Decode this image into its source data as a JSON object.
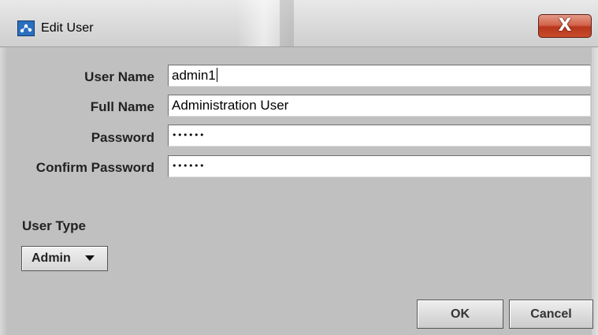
{
  "window": {
    "title": "Edit User",
    "close_label": "X"
  },
  "form": {
    "user_name": {
      "label": "User Name",
      "value": "admin1"
    },
    "full_name": {
      "label": "Full Name",
      "value": "Administration User"
    },
    "password": {
      "label": "Password",
      "value": "••••••"
    },
    "confirm_password": {
      "label": "Confirm Password",
      "value": "••••••"
    }
  },
  "user_type": {
    "label": "User Type",
    "selected": "Admin"
  },
  "buttons": {
    "ok": "OK",
    "cancel": "Cancel"
  },
  "colors": {
    "dialog_background": "#c0c0c0",
    "close_button": "#c94a2c"
  },
  "icons": {
    "app": "java-app-icon",
    "close": "close-icon",
    "dropdown": "chevron-down-icon"
  }
}
